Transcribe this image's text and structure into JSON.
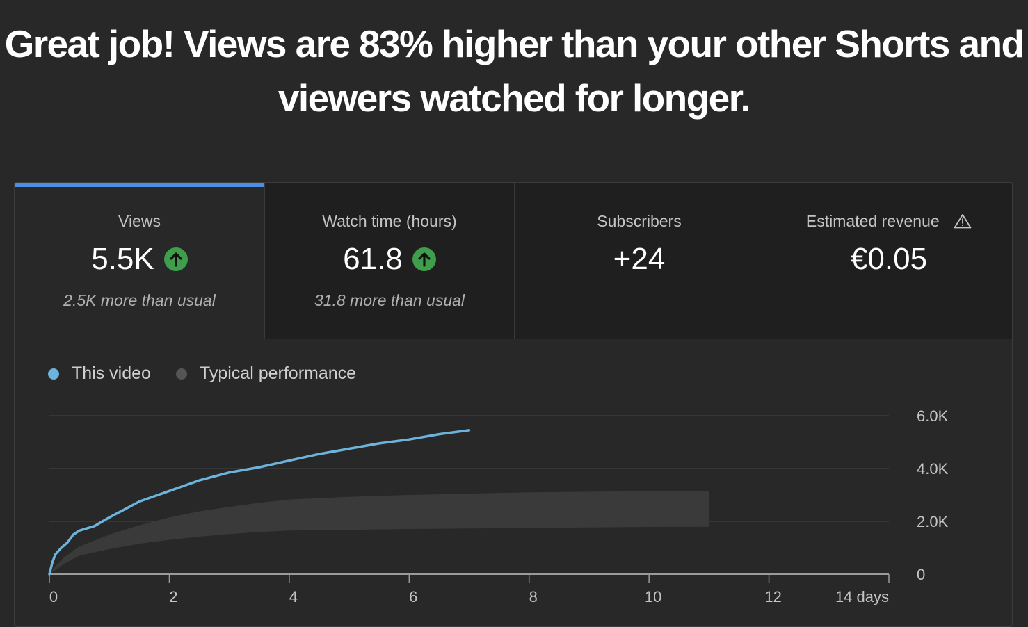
{
  "headline": {
    "line1": "Great job! Views are 83% higher than your other Shorts and",
    "line2": "viewers watched for longer."
  },
  "tabs": [
    {
      "label": "Views",
      "value": "5.5K",
      "sub": "2.5K more than usual",
      "trend": "up",
      "selected": true
    },
    {
      "label": "Watch time (hours)",
      "value": "61.8",
      "sub": "31.8 more than usual",
      "trend": "up",
      "selected": false
    },
    {
      "label": "Subscribers",
      "value": "+24",
      "sub": "",
      "trend": "none",
      "selected": false
    },
    {
      "label": "Estimated revenue",
      "value": "€0.05",
      "sub": "",
      "trend": "none",
      "selected": false,
      "icon": "warning-icon"
    }
  ],
  "colors": {
    "accent": "#4a8ee6",
    "this_video": "#6cb4dc",
    "typical": "#555555",
    "typical_band": "#3a3a3a",
    "up_badge": "#3f9e4c"
  },
  "chart_data": {
    "type": "line",
    "legend": [
      "This video",
      "Typical performance"
    ],
    "legend_position": "top-left",
    "x_ticks": [
      "0",
      "2",
      "4",
      "6",
      "8",
      "10",
      "12",
      "14 days"
    ],
    "y_ticks": [
      "0",
      "2.0K",
      "4.0K",
      "6.0K"
    ],
    "xlim": [
      0,
      14
    ],
    "ylim": [
      0,
      6000
    ],
    "grid": true,
    "series": [
      {
        "name": "This video",
        "x": [
          0,
          0.05,
          0.1,
          0.2,
          0.3,
          0.4,
          0.5,
          0.75,
          1.0,
          1.25,
          1.5,
          1.75,
          2.0,
          2.5,
          3.0,
          3.5,
          4.0,
          4.5,
          5.0,
          5.5,
          6.0,
          6.5,
          7.0
        ],
        "y": [
          0,
          450,
          750,
          1000,
          1200,
          1500,
          1650,
          1820,
          2150,
          2450,
          2750,
          2950,
          3150,
          3550,
          3850,
          4050,
          4300,
          4550,
          4750,
          4950,
          5100,
          5300,
          5450
        ]
      },
      {
        "name": "Typical performance",
        "band": true,
        "x": [
          0,
          0.1,
          0.25,
          0.5,
          1.0,
          1.5,
          2.0,
          2.5,
          3.0,
          3.5,
          4.0,
          5.0,
          6.0,
          7.0,
          8.0,
          9.0,
          10.0,
          11.0
        ],
        "low": [
          0,
          150,
          400,
          700,
          950,
          1150,
          1300,
          1420,
          1520,
          1600,
          1650,
          1680,
          1710,
          1730,
          1750,
          1770,
          1790,
          1800
        ],
        "high": [
          0,
          300,
          650,
          1050,
          1500,
          1850,
          2150,
          2380,
          2550,
          2700,
          2830,
          2930,
          3000,
          3050,
          3100,
          3120,
          3140,
          3150
        ]
      }
    ]
  }
}
